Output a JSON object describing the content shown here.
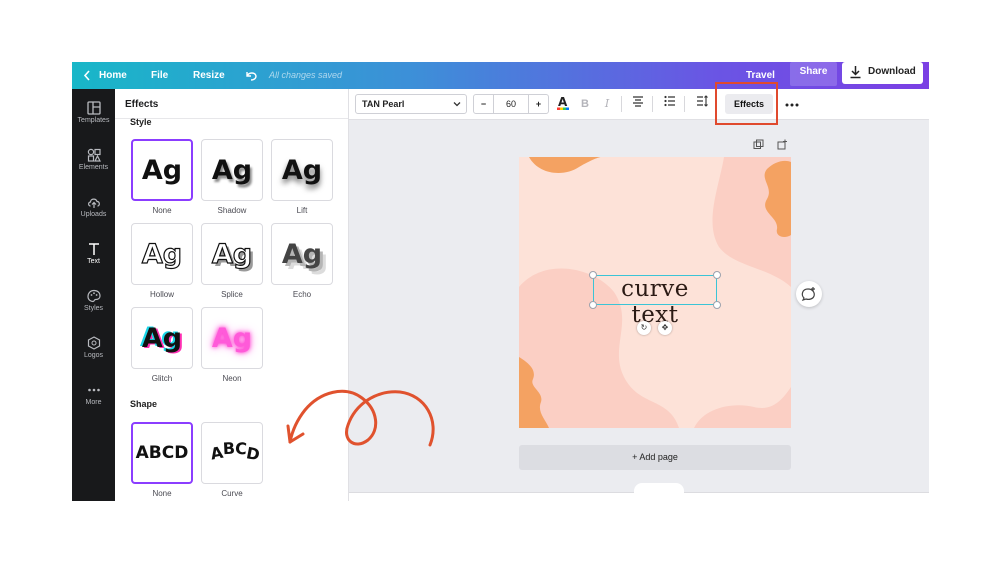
{
  "topbar": {
    "home": "Home",
    "file": "File",
    "resize": "Resize",
    "saved": "All changes saved",
    "travel": "Travel",
    "share": "Share",
    "download": "Download"
  },
  "rail": {
    "items": [
      {
        "label": "Templates",
        "icon": "templates-icon"
      },
      {
        "label": "Elements",
        "icon": "elements-icon"
      },
      {
        "label": "Uploads",
        "icon": "uploads-icon"
      },
      {
        "label": "Text",
        "icon": "text-icon"
      },
      {
        "label": "Styles",
        "icon": "styles-icon"
      },
      {
        "label": "Logos",
        "icon": "logos-icon"
      },
      {
        "label": "More",
        "icon": "more-icon"
      }
    ]
  },
  "panel": {
    "title": "Effects",
    "style_label": "Style",
    "shape_label": "Shape",
    "styles": [
      {
        "sample": "Ag",
        "label": "None"
      },
      {
        "sample": "Ag",
        "label": "Shadow"
      },
      {
        "sample": "Ag",
        "label": "Lift"
      },
      {
        "sample": "Ag",
        "label": "Hollow"
      },
      {
        "sample": "Ag",
        "label": "Splice"
      },
      {
        "sample": "Ag",
        "label": "Echo"
      },
      {
        "sample": "Ag",
        "label": "Glitch"
      },
      {
        "sample": "Ag",
        "label": "Neon"
      }
    ],
    "shapes": [
      {
        "sample": "ABCD",
        "label": "None"
      },
      {
        "sample": "ABCD",
        "label": "Curve"
      }
    ]
  },
  "toolbar": {
    "font": "TAN Pearl",
    "size": "60",
    "minus": "−",
    "plus": "+",
    "effects": "Effects",
    "text_color_icon": "A"
  },
  "canvas": {
    "text": "curve text",
    "add_page": "+ Add page"
  },
  "colors": {
    "accent": "#8b3dff",
    "highlight": "#e04a2e",
    "artboard_bg": "#fde2d8",
    "blob_orange": "#f4a262",
    "blob_pink": "#fbcfc4",
    "arrow": "#e0522e"
  }
}
